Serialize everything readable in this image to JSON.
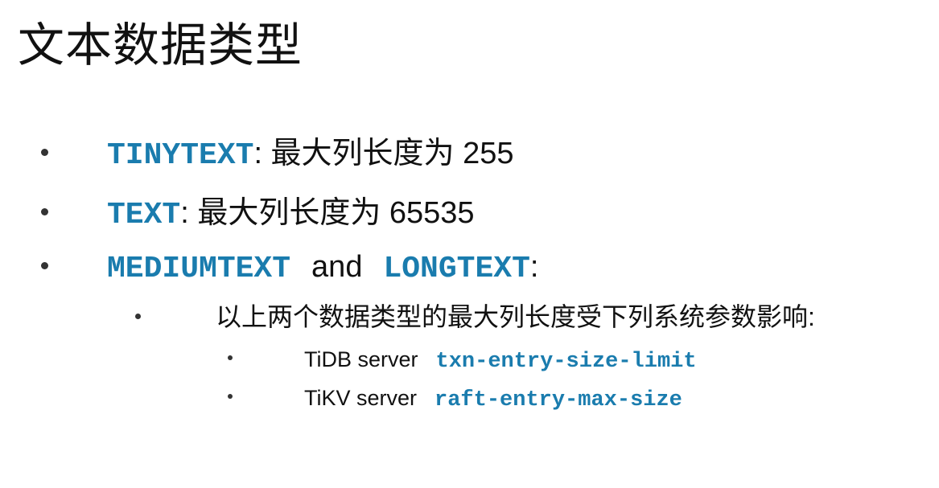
{
  "slide": {
    "title": "文本数据类型"
  },
  "items": [
    {
      "code": "TINYTEXT",
      "sep": ":",
      "text": " 最大列长度为 255"
    },
    {
      "code": "TEXT",
      "sep": ":",
      "text": " 最大列长度为 65535"
    },
    {
      "code1": "MEDIUMTEXT",
      "conj": "and",
      "code2": "LONGTEXT",
      "sep": ":"
    }
  ],
  "sub_item": {
    "text": "以上两个数据类型的最大列长度受下列系统参数影响:"
  },
  "params": [
    {
      "label": "TiDB server",
      "code": "txn-entry-size-limit"
    },
    {
      "label": "TiKV server",
      "code": "raft-entry-max-size"
    }
  ],
  "colors": {
    "code": "#1a7cae",
    "text": "#111111"
  }
}
